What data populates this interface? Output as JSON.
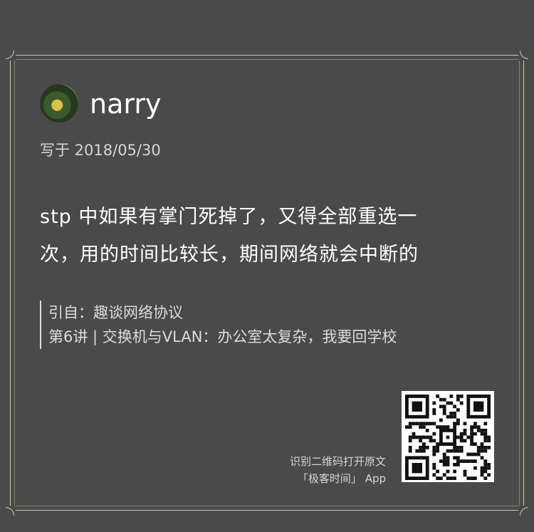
{
  "card": {
    "username": "narry",
    "written_on": "写于 2018/05/30",
    "content_lines": [
      "stp 中如果有掌门死掉了，又得全部重选一",
      "次，用的时间比较长，期间网络就会中断的"
    ],
    "quote_source": "引自：趣谈网络协议",
    "quote_lesson": "第6讲 | 交换机与VLAN：办公室太复杂，我要回学校",
    "qr_caption_line1": "识别二维码打开原文",
    "qr_caption_line2": "「极客时间」 App"
  },
  "colors": {
    "background": "#4a4a4a",
    "frame": "#cfc8b8",
    "text": "#ffffff",
    "secondary_text": "#d6d6d6"
  },
  "icons": {
    "avatar": "user-avatar-icon",
    "qr": "qr-code-icon"
  }
}
